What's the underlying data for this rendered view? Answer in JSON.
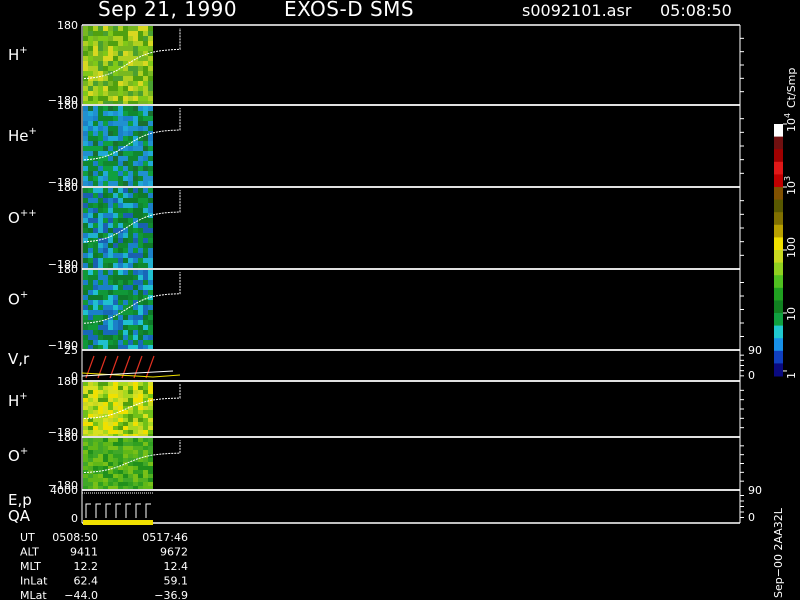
{
  "header": {
    "date": "Sep 21, 1990",
    "instrument": "EXOS-D SMS",
    "file": "s0092101.asr",
    "time": "05:08:50"
  },
  "colorbar": {
    "unit": "Ct/Smp",
    "labels": [
      {
        "text": "10",
        "sup": "4",
        "level": 1.0
      },
      {
        "text": "10",
        "sup": "3",
        "level": 0.75
      },
      {
        "text": "100",
        "sup": "",
        "level": 0.5
      },
      {
        "text": "10",
        "sup": "",
        "level": 0.25
      },
      {
        "text": "1",
        "sup": "",
        "level": 0.02
      }
    ],
    "colors": [
      "#0a0a80",
      "#1040c0",
      "#1890e8",
      "#20c8d0",
      "#10a040",
      "#108020",
      "#20a020",
      "#50c020",
      "#90d020",
      "#c8d820",
      "#f0e000",
      "#b8a000",
      "#807000",
      "#585800",
      "#805000",
      "#c00000",
      "#e01818",
      "#a00000",
      "#701010",
      "#ffffff"
    ]
  },
  "panels": [
    {
      "name": "H",
      "sup": "+",
      "top_tick": "180",
      "bottom_tick": "−180"
    },
    {
      "name": "He",
      "sup": "+",
      "top_tick": "180",
      "bottom_tick": "−180"
    },
    {
      "name": "O",
      "sup": "++",
      "top_tick": "180",
      "bottom_tick": "−180"
    },
    {
      "name": "O",
      "sup": "+",
      "top_tick": "180",
      "bottom_tick": "−180"
    },
    {
      "name": "V,r",
      "sup": "",
      "top_tick": "25",
      "bottom_tick": "0",
      "right_top": "90",
      "right_bottom": "0"
    },
    {
      "name": "H",
      "sup": "+",
      "top_tick": "180",
      "bottom_tick": "−180"
    },
    {
      "name": "O",
      "sup": "+",
      "top_tick": "180",
      "bottom_tick": "−180"
    },
    {
      "name": "E,p",
      "sup": "",
      "top_tick": "4000",
      "bottom_tick": "0",
      "right_top": "90",
      "right_bottom": "0",
      "sub_name": "QA"
    }
  ],
  "footer": {
    "rows": [
      {
        "label": "UT",
        "start": "0508:50",
        "end": "0517:46"
      },
      {
        "label": "ALT",
        "start": "9411",
        "end": "9672"
      },
      {
        "label": "MLT",
        "start": "12.2",
        "end": "12.4"
      },
      {
        "label": "InLat",
        "start": "62.4",
        "end": "59.1"
      },
      {
        "label": "MLat",
        "start": "−44.0",
        "end": "−36.9"
      }
    ],
    "version": "Sep−00  2AA32L"
  },
  "chart_data": {
    "type": "heatmap",
    "title": "Sep 21, 1990   EXOS-D SMS",
    "x_range_ut": [
      "0508:50",
      "0517:46"
    ],
    "y_range_pitch": [
      -180,
      180
    ],
    "color_scale": "log",
    "color_range": [
      1,
      10000
    ],
    "series": [
      {
        "name": "H+",
        "dominant_level": "100"
      },
      {
        "name": "He+",
        "dominant_level": "10"
      },
      {
        "name": "O++",
        "dominant_level": "10"
      },
      {
        "name": "O+",
        "dominant_level": "10"
      }
    ]
  }
}
